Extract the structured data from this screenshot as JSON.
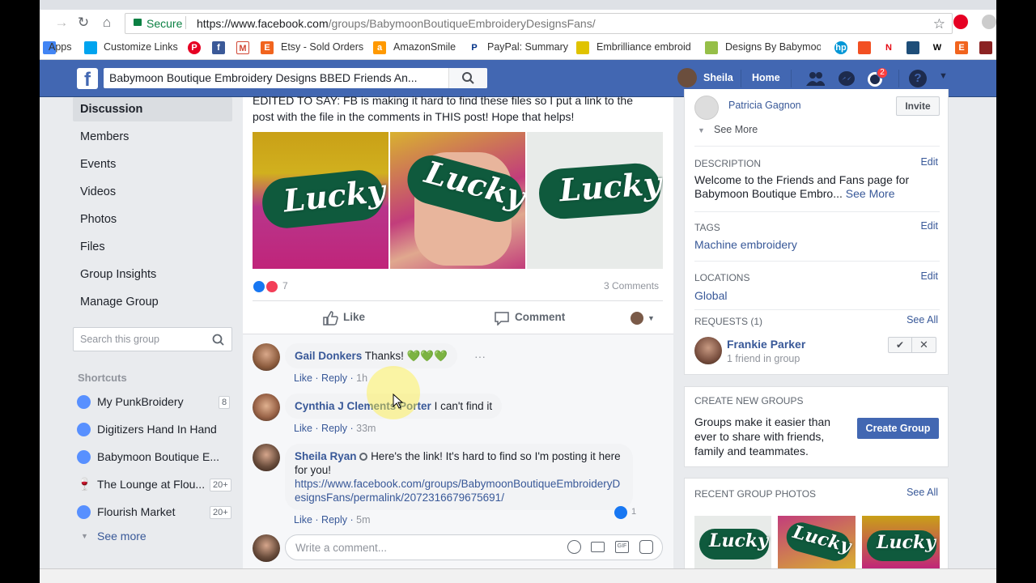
{
  "browser": {
    "secure_label": "Secure",
    "url_host": "https://www.facebook.com",
    "url_path": "/groups/BabymoonBoutiqueEmbroideryDesignsFans/",
    "bookmarks": [
      {
        "label": "Apps",
        "icon": "apps-grid-icon",
        "color": "#4285f4"
      },
      {
        "label": "Customize Links",
        "icon": "windows-icon",
        "color": "#00a4ef"
      },
      {
        "label": "",
        "icon": "pinterest-icon",
        "color": "#e60023"
      },
      {
        "label": "",
        "icon": "facebook-icon",
        "color": "#3b5998"
      },
      {
        "label": "",
        "icon": "gmail-icon",
        "color": "#d14836"
      },
      {
        "label": "Etsy - Sold Orders",
        "icon": "etsy-icon",
        "color": "#f1641e"
      },
      {
        "label": "AmazonSmile",
        "icon": "amazon-icon",
        "color": "#ff9900"
      },
      {
        "label": "PayPal: Summary",
        "icon": "paypal-icon",
        "color": "#003087"
      },
      {
        "label": "Embrilliance embroid",
        "icon": "embrilliance-icon",
        "color": "#e0c300"
      },
      {
        "label": "Designs By Babymoo",
        "icon": "shopify-icon",
        "color": "#96bf48"
      }
    ]
  },
  "header": {
    "search_value": "Babymoon Boutique Embroidery Designs BBED Friends An...",
    "user_name": "Sheila",
    "home_label": "Home",
    "notif_count": "2",
    "colors": {
      "brand": "#4267b2"
    }
  },
  "left_nav": {
    "items": [
      {
        "label": "Discussion",
        "active": true
      },
      {
        "label": "Members"
      },
      {
        "label": "Events"
      },
      {
        "label": "Videos"
      },
      {
        "label": "Photos"
      },
      {
        "label": "Files"
      },
      {
        "label": "Group Insights"
      },
      {
        "label": "Manage Group"
      }
    ],
    "search_placeholder": "Search this group",
    "shortcuts_title": "Shortcuts",
    "shortcuts": [
      {
        "label": "My PunkBroidery",
        "count": "8"
      },
      {
        "label": "Digitizers Hand In Hand",
        "count": ""
      },
      {
        "label": "Babymoon Boutique E...",
        "count": ""
      },
      {
        "label": "The Lounge at Flou...",
        "count": "20+"
      },
      {
        "label": "Flourish Market",
        "count": "20+"
      }
    ],
    "see_more": "See more"
  },
  "post": {
    "text_line1": "EDITED TO SAY: FB is making it hard to find these files so I put a link to the",
    "text_line2": "post with the file in the comments in THIS post! Hope that helps!",
    "photo_text": "Lucky",
    "reaction_count": "7",
    "comments_count": "3 Comments",
    "like_label": "Like",
    "comment_label": "Comment"
  },
  "comments": [
    {
      "author": "Gail Donkers",
      "text": "Thanks! 💚💚💚",
      "like": "Like",
      "reply": "Reply",
      "time": "1h"
    },
    {
      "author": "Cynthia J Clements Porter",
      "text": "I can't find it",
      "like": "Like",
      "reply": "Reply",
      "time": "33m"
    },
    {
      "author": "Sheila Ryan",
      "text": "Here's the link! It's hard to find so I'm posting it here for you!",
      "link": "https://www.facebook.com/groups/BabymoonBoutiqueEmbroideryDesignsFans/permalink/2072316679675691/",
      "link_line1": "https://www.facebook.com/groups/BabymoonBoutiqueEmbroideryD",
      "link_line2": "esignsFans/permalink/2072316679675691/",
      "like": "Like",
      "reply": "Reply",
      "time": "5m",
      "likes": "1"
    }
  ],
  "write_comment_placeholder": "Write a comment...",
  "right": {
    "member_name": "Patricia Gagnon",
    "invite_label": "Invite",
    "see_more": "See More",
    "description_title": "DESCRIPTION",
    "description_text1": "Welcome to the Friends and Fans page for",
    "description_text2": "Babymoon Boutique Embro...",
    "description_see_more": "See More",
    "edit_label": "Edit",
    "tags_title": "TAGS",
    "tag": "Machine embroidery",
    "locations_title": "LOCATIONS",
    "location": "Global",
    "requests_title": "REQUESTS (1)",
    "see_all": "See All",
    "request_name": "Frankie Parker",
    "request_sub": "1 friend in group",
    "create_title": "CREATE NEW GROUPS",
    "create_text1": "Groups make it easier than",
    "create_text2": "ever to share with friends,",
    "create_text3": "family and teammates.",
    "create_button": "Create Group",
    "photos_title": "RECENT GROUP PHOTOS",
    "photo_text": "Lucky"
  }
}
